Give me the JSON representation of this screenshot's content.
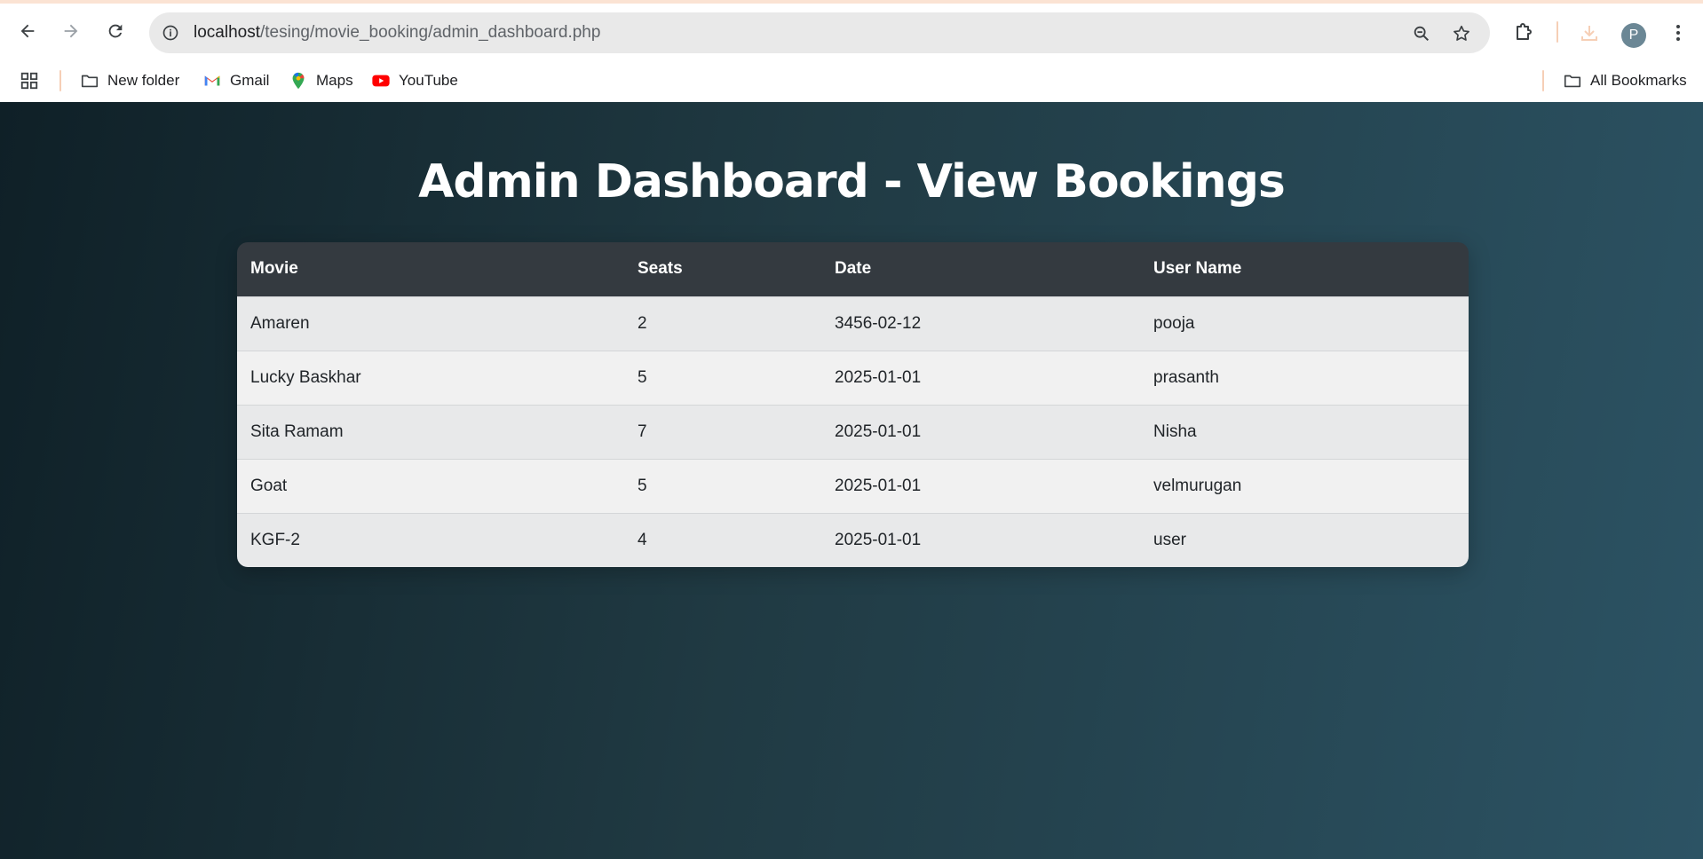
{
  "browser": {
    "url_host": "localhost",
    "url_path": "/tesing/movie_booking/admin_dashboard.php",
    "profile_initial": "P",
    "bookmarks": [
      {
        "label": "New folder",
        "icon": "folder-icon"
      },
      {
        "label": "Gmail",
        "icon": "gmail-icon"
      },
      {
        "label": "Maps",
        "icon": "maps-icon"
      },
      {
        "label": "YouTube",
        "icon": "youtube-icon"
      }
    ],
    "all_bookmarks_label": "All Bookmarks"
  },
  "page": {
    "title": "Admin Dashboard - View Bookings",
    "background_colors": [
      "#0f2027",
      "#203a43",
      "#2c5364"
    ]
  },
  "table": {
    "headers": [
      "Movie",
      "Seats",
      "Date",
      "User Name"
    ],
    "rows": [
      [
        "Amaren",
        "2",
        "3456-02-12",
        "pooja"
      ],
      [
        "Lucky Baskhar",
        "5",
        "2025-01-01",
        "prasanth"
      ],
      [
        "Sita Ramam",
        "7",
        "2025-01-01",
        "Nisha"
      ],
      [
        "Goat",
        "5",
        "2025-01-01",
        "velmurugan"
      ],
      [
        "KGF-2",
        "4",
        "2025-01-01",
        "user"
      ]
    ],
    "header_color": "#343a40"
  }
}
